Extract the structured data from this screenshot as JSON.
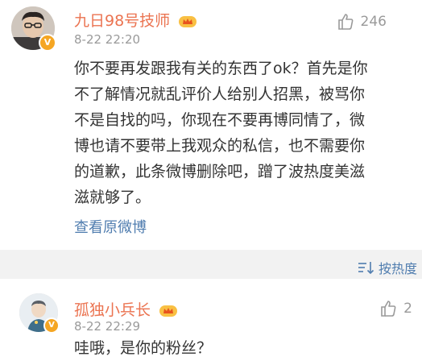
{
  "comments": [
    {
      "username": "九日98号技师",
      "time": "8-22 22:20",
      "likes": "246",
      "badge": "V",
      "text_lines": [
        "你不要再发跟我有关的东西了ok？首先是你",
        "不了解情况就乱评价人给别人招黑，被骂你",
        "不是自找的吗，你现在不要再博同情了，微",
        "博也请不要带上我观众的私信，也不需要你",
        "的道歉，此条微博删除吧，蹭了波热度美滋",
        "滋就够了。"
      ],
      "view_original": "查看原微博"
    },
    {
      "username": "孤独小兵长",
      "time": "8-22 22:29",
      "likes": "2",
      "badge": "V",
      "text_lines": [
        "哇哦，是你的粉丝？"
      ]
    }
  ],
  "sort": {
    "label": "按热度"
  },
  "colors": {
    "username": "#eb7350",
    "link": "#507daf",
    "muted": "#9a9a9a",
    "divider": "#f2f2f2",
    "badge": "#f5a623"
  }
}
